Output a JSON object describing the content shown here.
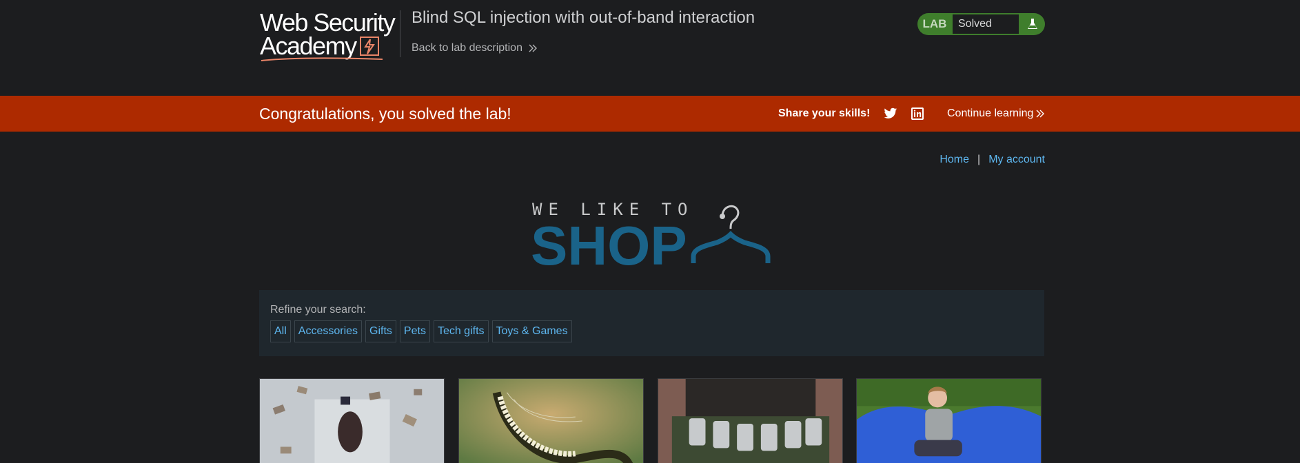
{
  "header": {
    "logo_line1": "Web Security",
    "logo_line2": "Academy",
    "lab_title": "Blind SQL injection with out-of-band interaction",
    "back_link": "Back to lab description",
    "lab_badge": "LAB",
    "lab_status": "Solved"
  },
  "banner": {
    "message": "Congratulations, you solved the lab!",
    "share": "Share your skills!",
    "continue": "Continue learning"
  },
  "nav": {
    "home": "Home",
    "separator": "|",
    "account": "My account"
  },
  "shop_logo": {
    "line1": "WE LIKE TO",
    "line2": "SHOP"
  },
  "search": {
    "label": "Refine your search:",
    "filters": [
      "All",
      "Accessories",
      "Gifts",
      "Pets",
      "Tech gifts",
      "Toys & Games"
    ]
  },
  "icons": {
    "twitter": "twitter-icon",
    "linkedin": "linkedin-icon",
    "flask": "flask-icon",
    "chevrons": "double-chevron-right-icon"
  },
  "colors": {
    "background": "#1c1d1f",
    "banner": "#ad2a00",
    "lab_green": "#3f7e2c",
    "link_blue": "#5eb7f0",
    "shop_blue": "#1a6389"
  }
}
